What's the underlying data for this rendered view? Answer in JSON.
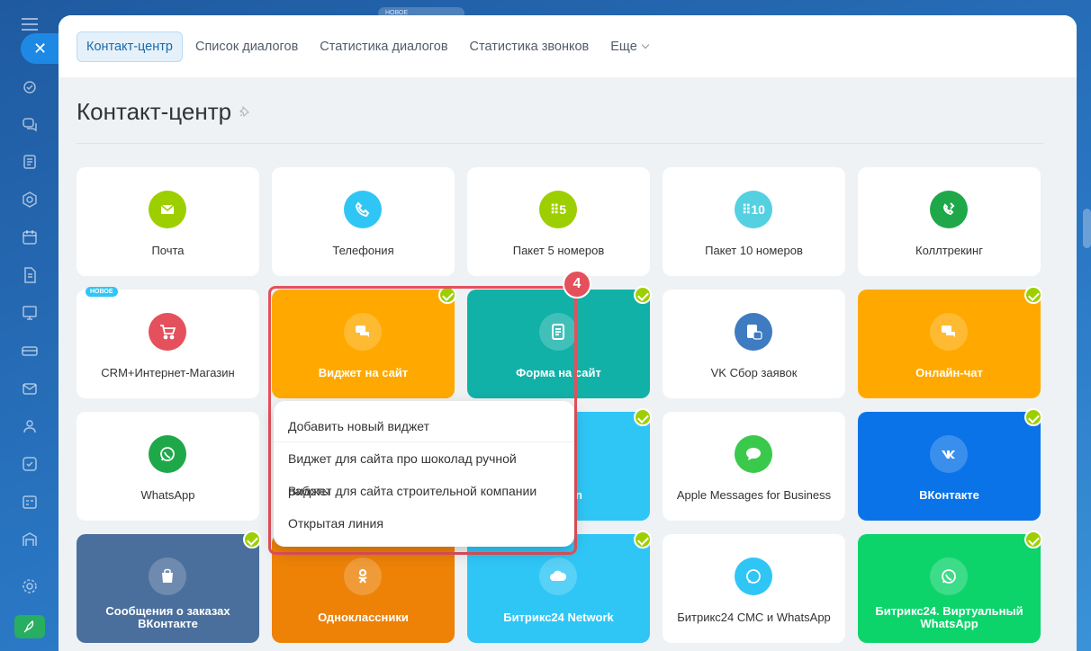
{
  "app": {
    "top_badge": "НОВОЕ",
    "close_glyph": "✕"
  },
  "tabs": [
    {
      "label": "Контакт-центр"
    },
    {
      "label": "Список диалогов"
    },
    {
      "label": "Статистика диалогов"
    },
    {
      "label": "Статистика звонков"
    },
    {
      "label": "Еще"
    }
  ],
  "page": {
    "title": "Контакт-центр"
  },
  "tiles": [
    {
      "label": "Почта",
      "color": "#9dcf00",
      "icon": "mail-icon"
    },
    {
      "label": "Телефония",
      "color": "#2fc6f6",
      "icon": "phone-icon"
    },
    {
      "label": "Пакет 5 номеров",
      "color": "#9dcf00",
      "icon_text": "⠿5"
    },
    {
      "label": "Пакет 10 номеров",
      "color": "#55d0e0",
      "icon_text": "⠿10"
    },
    {
      "label": "Коллтрекинг",
      "color": "#1fa84a",
      "icon": "call-tracking-icon"
    },
    {
      "label": "CRM+Интернет-Магазин",
      "color": "#e4505c",
      "icon": "cart-icon",
      "badge": "НОВОЕ"
    },
    {
      "label": "Виджет на сайт",
      "color": "#ffa900",
      "icon": "chat-icon",
      "checked": true
    },
    {
      "label": "Форма на сайт",
      "color": "#12b1a8",
      "icon": "form-icon",
      "checked": true
    },
    {
      "label": "VK Сбор заявок",
      "color": "#3e7bc1",
      "icon": "vk-form-icon"
    },
    {
      "label": "Онлайн-чат",
      "color": "#ffa900",
      "icon": "chat-icon",
      "checked": true
    },
    {
      "label": "WhatsApp",
      "color": "#1fa84a",
      "icon": "whatsapp-icon"
    },
    {
      "label": "n",
      "color": "#2fc6f6",
      "checked": true
    },
    {
      "label": "Apple Messages for Business",
      "color": "#3bc94b",
      "icon": "message-icon"
    },
    {
      "label": "ВКонтакте",
      "color": "#0a73e8",
      "icon": "vk-icon",
      "checked": true
    },
    {
      "label": "Сообщения о заказах ВКонтакте",
      "color": "#4a6f9c",
      "icon": "vk-orders-icon",
      "checked": true
    },
    {
      "label": "Одноклассники",
      "color": "#ed8207",
      "icon": "ok-icon"
    },
    {
      "label": "Битрикс24 Network",
      "color": "#2fc6f6",
      "icon": "cloud-icon",
      "checked": true
    },
    {
      "label": "Битрикс24 СМС и WhatsApp",
      "color": "#2fc6f6",
      "icon": "sms-icon"
    },
    {
      "label": "Битрикс24. Виртуальный WhatsApp",
      "color": "#0cd46b",
      "icon": "whatsapp-icon",
      "checked": true
    }
  ],
  "step_marker": "4",
  "widget_menu": [
    {
      "label": "Добавить новый виджет"
    },
    {
      "label": "Виджет для сайта про шоколад ручной работы"
    },
    {
      "label": "Виджет для сайта строительной компании"
    },
    {
      "label": "Открытая линия"
    }
  ]
}
